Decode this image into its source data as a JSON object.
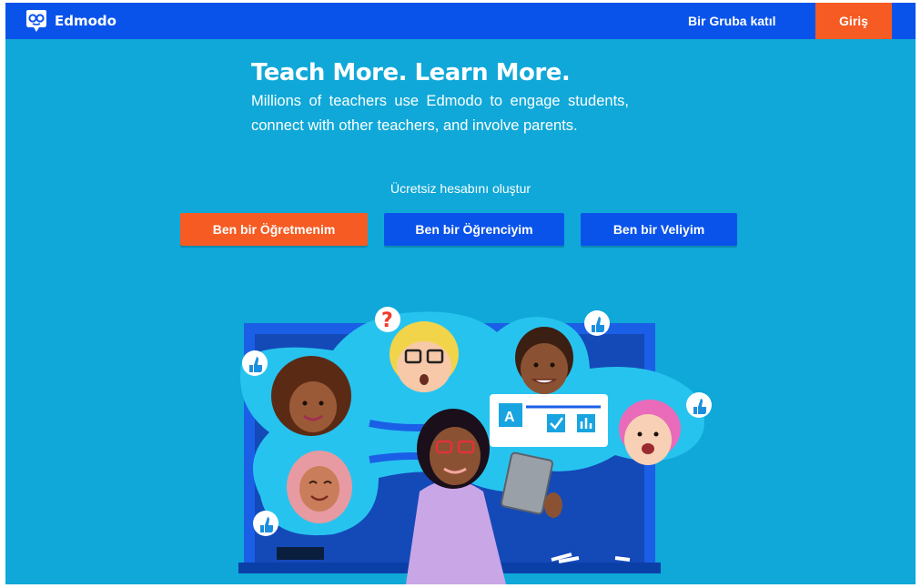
{
  "header": {
    "brand": "Edmodo",
    "join_group": "Bir Gruba katıl",
    "login": "Giriş"
  },
  "hero": {
    "title": "Teach More. Learn More.",
    "description": "Millions of teachers use Edmodo to engage students, connect with other teachers, and involve parents."
  },
  "signup": {
    "caption": "Ücretsiz hesabını oluştur",
    "teacher": "Ben bir Öğretmenim",
    "student": "Ben bir Öğrenciyim",
    "parent": "Ben bir Veliyim"
  },
  "illustration": {
    "question_mark": "?",
    "board_letter": "A"
  },
  "colors": {
    "header_bg": "#0a53ea",
    "page_bg": "#0fa8d8",
    "accent_orange": "#f55b22",
    "button_blue": "#0a53ea"
  },
  "icons": [
    "edmodo-logo-icon",
    "thumbs-up-icon",
    "question-icon",
    "tablet-icon",
    "checkbox-icon",
    "bar-chart-icon"
  ]
}
